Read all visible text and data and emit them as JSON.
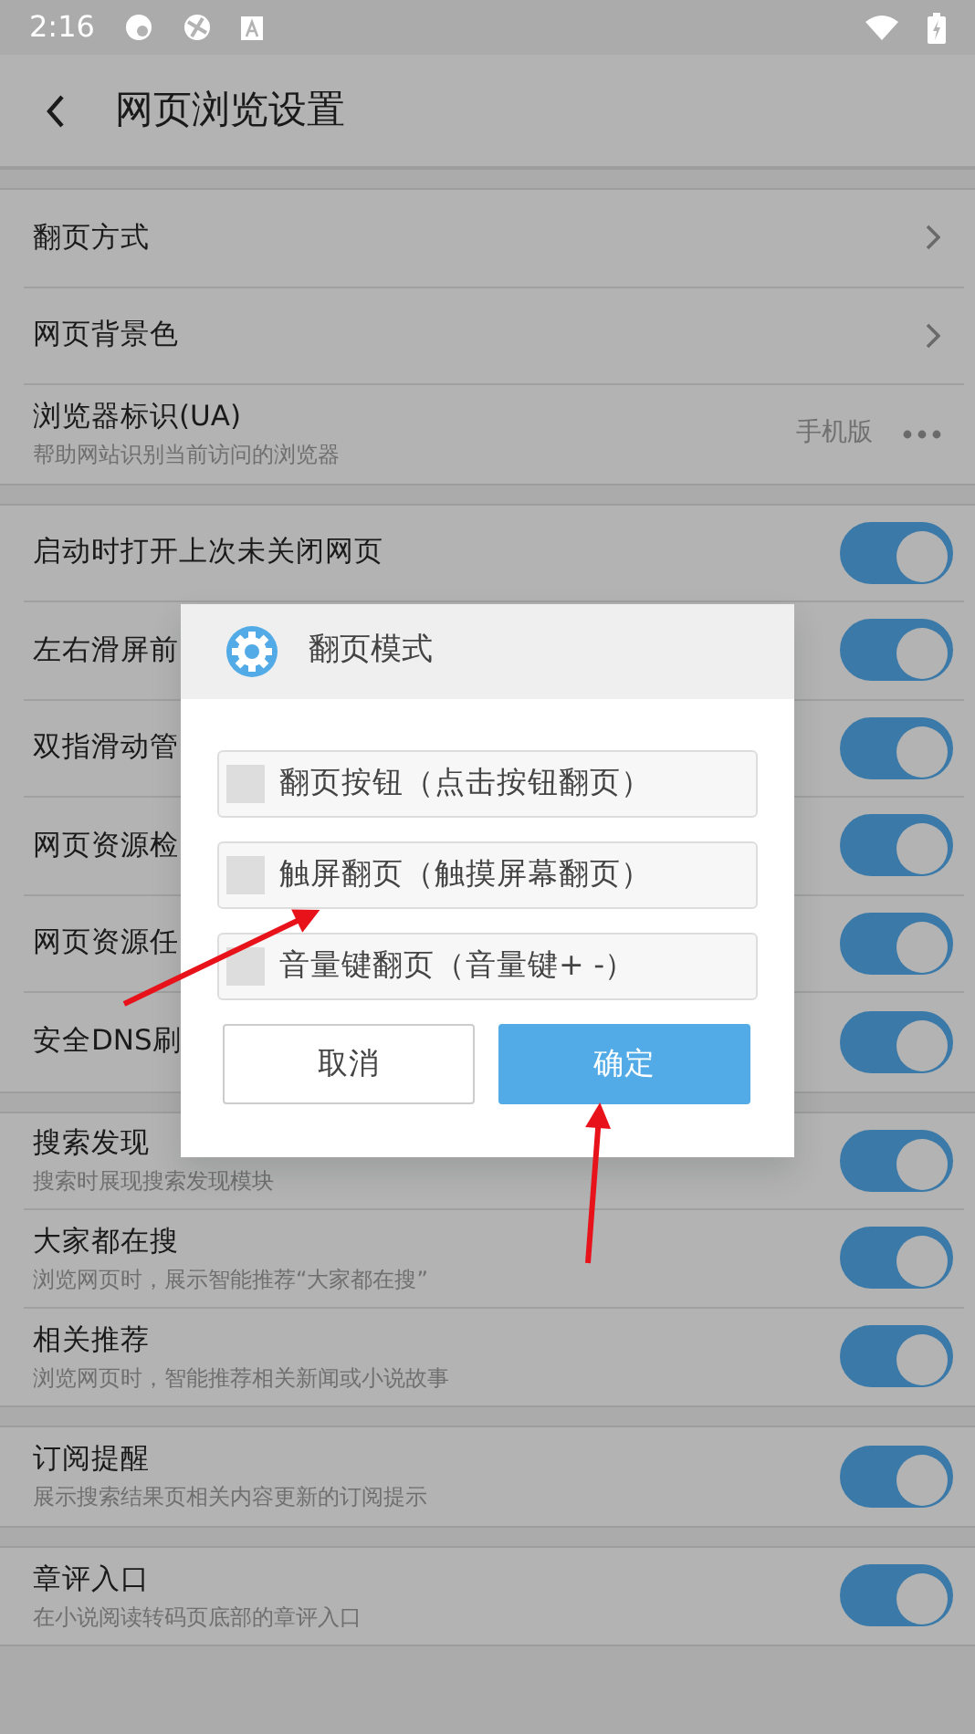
{
  "status_bar": {
    "time": "2:16"
  },
  "header": {
    "title": "网页浏览设置"
  },
  "sections": [
    {
      "rows": [
        {
          "kind": "link",
          "label": "翻页方式"
        },
        {
          "kind": "link",
          "label": "网页背景色"
        },
        {
          "kind": "more",
          "label": "浏览器标识(UA)",
          "subtitle": "帮助网站识别当前访问的浏览器",
          "value": "手机版"
        }
      ]
    },
    {
      "rows": [
        {
          "kind": "toggle",
          "label": "启动时打开上次未关闭网页",
          "on": true
        },
        {
          "kind": "toggle",
          "label": "左右滑屏前",
          "on": true
        },
        {
          "kind": "toggle",
          "label": "双指滑动管",
          "on": true
        },
        {
          "kind": "toggle",
          "label": "网页资源检",
          "on": true
        },
        {
          "kind": "toggle",
          "label": "网页资源任",
          "on": true
        },
        {
          "kind": "toggle",
          "label": "安全DNS刷",
          "on": true
        }
      ]
    },
    {
      "rows": [
        {
          "kind": "toggle",
          "label": "搜索发现",
          "subtitle": "搜索时展现搜索发现模块",
          "on": true
        },
        {
          "kind": "toggle",
          "label": "大家都在搜",
          "subtitle": "浏览网页时，展示智能推荐“大家都在搜”",
          "on": true
        },
        {
          "kind": "toggle",
          "label": "相关推荐",
          "subtitle": "浏览网页时，智能推荐相关新闻或小说故事",
          "on": true
        }
      ]
    },
    {
      "rows": [
        {
          "kind": "toggle",
          "label": "订阅提醒",
          "subtitle": "展示搜索结果页相关内容更新的订阅提示",
          "on": true
        }
      ]
    },
    {
      "rows": [
        {
          "kind": "toggle",
          "label": "章评入口",
          "subtitle": "在小说阅读转码页底部的章评入口",
          "on": true
        }
      ]
    }
  ],
  "dialog": {
    "title": "翻页模式",
    "options": [
      {
        "label": "翻页按钮（点击按钮翻页）",
        "checked": false
      },
      {
        "label": "触屏翻页（触摸屏幕翻页）",
        "checked": false
      },
      {
        "label": "音量键翻页（音量键+ -）",
        "checked": false
      }
    ],
    "buttons": [
      {
        "kind": "secondary",
        "label": "取消"
      },
      {
        "kind": "primary",
        "label": "确定"
      }
    ]
  }
}
